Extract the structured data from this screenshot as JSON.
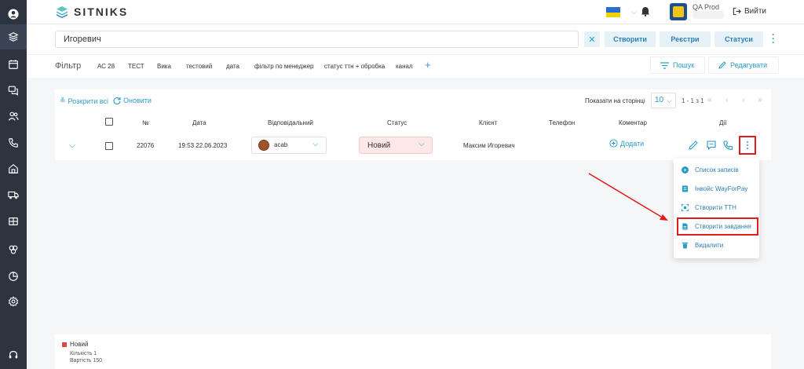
{
  "app": {
    "logo_text": "SITNIKS"
  },
  "user": {
    "name": "QA Prod",
    "logout_label": "Вийти"
  },
  "search": {
    "value": "Игоревич",
    "clear_icon": "✕"
  },
  "actions": {
    "create": "Створити",
    "registers": "Реєстри",
    "statuses": "Статуси"
  },
  "filter": {
    "label": "Фільтр",
    "tabs": [
      "АС 28",
      "ТЕСТ",
      "Вика",
      "тестовий",
      "дата",
      "фільтр по менеджер",
      "статус ттн + обробка",
      "канал"
    ],
    "add": "+",
    "search_label": "Пошук",
    "edit_label": "Редагувати"
  },
  "toolbar": {
    "expand_all": "Розкрити всі",
    "refresh": "Оновити",
    "per_page_label": "Показати на сторінці",
    "per_page_value": "10",
    "range": "1 - 1 з 1"
  },
  "table": {
    "headers": {
      "number": "№",
      "date": "Дата",
      "responsible": "Відповідальний",
      "status": "Статус",
      "client": "Клієнт",
      "phone": "Телефон",
      "comment": "Коментар",
      "actions": "Дії"
    },
    "row": {
      "id": "22076",
      "date": "19:53 22.06.2023",
      "responsible": "acab",
      "status": "Новий",
      "client": "Максим Игоревич",
      "add_comment": "Додати"
    }
  },
  "menu": {
    "items": [
      "Список записів",
      "Інвойс WayForPay",
      "Створити ТТН",
      "Створити завдання",
      "Видалити"
    ]
  },
  "legend": {
    "status": "Новий",
    "count": "Кількість 1",
    "value": "Вартість 150"
  },
  "colors": {
    "accent": "#2b9ac6",
    "highlight": "#e01b1b",
    "sidebar": "#2c3440",
    "status_new": "#e04545"
  }
}
